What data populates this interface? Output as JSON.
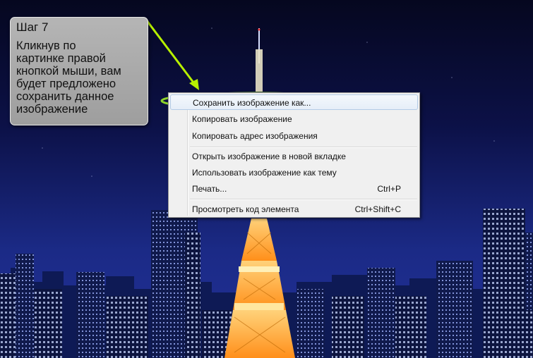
{
  "callout": {
    "step": "Шаг 7",
    "lines": [
      "Кликнув по",
      "картинке правой",
      "кнопкой мыши, вам",
      "будет предложено",
      "сохранить данное",
      "изображение"
    ]
  },
  "context_menu": {
    "items": [
      {
        "label": "Сохранить изображение как...",
        "shortcut": ""
      },
      {
        "label": "Копировать изображение",
        "shortcut": ""
      },
      {
        "label": "Копировать адрес изображения",
        "shortcut": ""
      },
      {
        "label": "Открыть изображение в новой вкладке",
        "shortcut": ""
      },
      {
        "label": "Использовать изображение как тему",
        "shortcut": ""
      },
      {
        "label": "Печать...",
        "shortcut": "Ctrl+P"
      },
      {
        "label": "Просмотреть код элемента",
        "shortcut": "Ctrl+Shift+C"
      }
    ]
  },
  "colors": {
    "highlight_ring": "#8fd42a",
    "arrow": "#b7f000",
    "sky_top": "#06082a",
    "tower": "#ffb02e"
  }
}
